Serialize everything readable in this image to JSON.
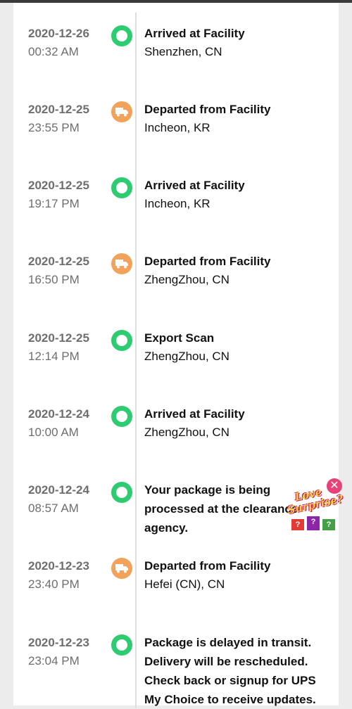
{
  "events": [
    {
      "date": "2020-12-26",
      "time": "00:32 AM",
      "status": "Arrived at Facility",
      "location": "Shenzhen, CN",
      "icon": "green-circle"
    },
    {
      "date": "2020-12-25",
      "time": "23:55 PM",
      "status": "Departed from Facility",
      "location": "Incheon, KR",
      "icon": "truck"
    },
    {
      "date": "2020-12-25",
      "time": "19:17 PM",
      "status": "Arrived at Facility",
      "location": "Incheon, KR",
      "icon": "green-circle"
    },
    {
      "date": "2020-12-25",
      "time": "16:50 PM",
      "status": "Departed from Facility",
      "location": "ZhengZhou, CN",
      "icon": "truck"
    },
    {
      "date": "2020-12-25",
      "time": "12:14 PM",
      "status": "Export Scan",
      "location": "ZhengZhou, CN",
      "icon": "green-circle"
    },
    {
      "date": "2020-12-24",
      "time": "10:00 AM",
      "status": "Arrived at Facility",
      "location": "ZhengZhou, CN",
      "icon": "green-circle"
    },
    {
      "date": "2020-12-24",
      "time": "08:57 AM",
      "status": "Your package is being processed at the clearance agency.",
      "location": "",
      "icon": "green-circle"
    },
    {
      "date": "2020-12-23",
      "time": "23:40 PM",
      "status": "Departed from Facility",
      "location": "Hefei (CN), CN",
      "icon": "truck"
    },
    {
      "date": "2020-12-23",
      "time": "23:04 PM",
      "status": "Package is delayed in transit. Delivery will be rescheduled. Check back or signup for UPS My Choice to receive updates.",
      "location": "",
      "icon": "green-circle"
    }
  ],
  "promo": {
    "line1": "Love",
    "line2": "Surprise?",
    "close": "✕",
    "box_mark": "?"
  },
  "colors": {
    "green": "#2ecc71",
    "orange": "#f2a25a",
    "line": "#dedede"
  }
}
